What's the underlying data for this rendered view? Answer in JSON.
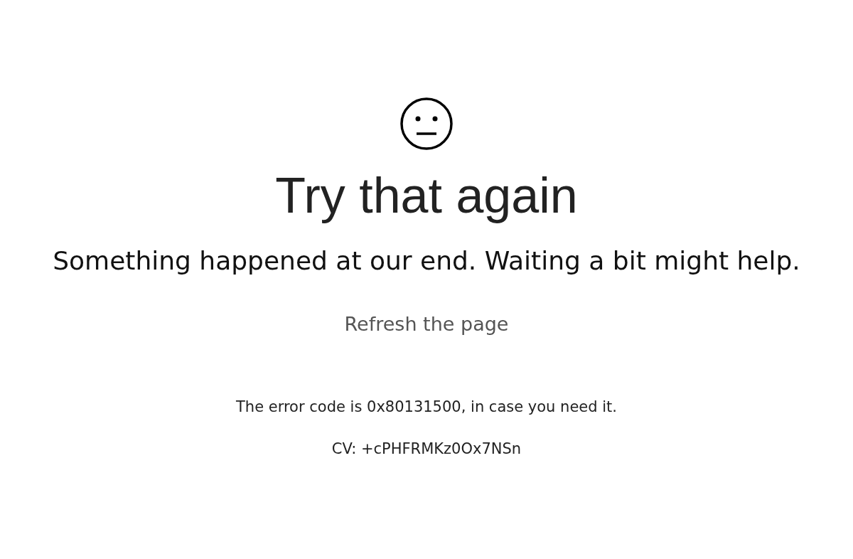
{
  "title": "Try that again",
  "message": "Something happened at our end. Waiting a bit might help.",
  "refresh_link": "Refresh the page",
  "error_code_text": "The error code is 0x80131500, in case you need it.",
  "cv_text": "CV: +cPHFRMKz0Ox7NSn"
}
